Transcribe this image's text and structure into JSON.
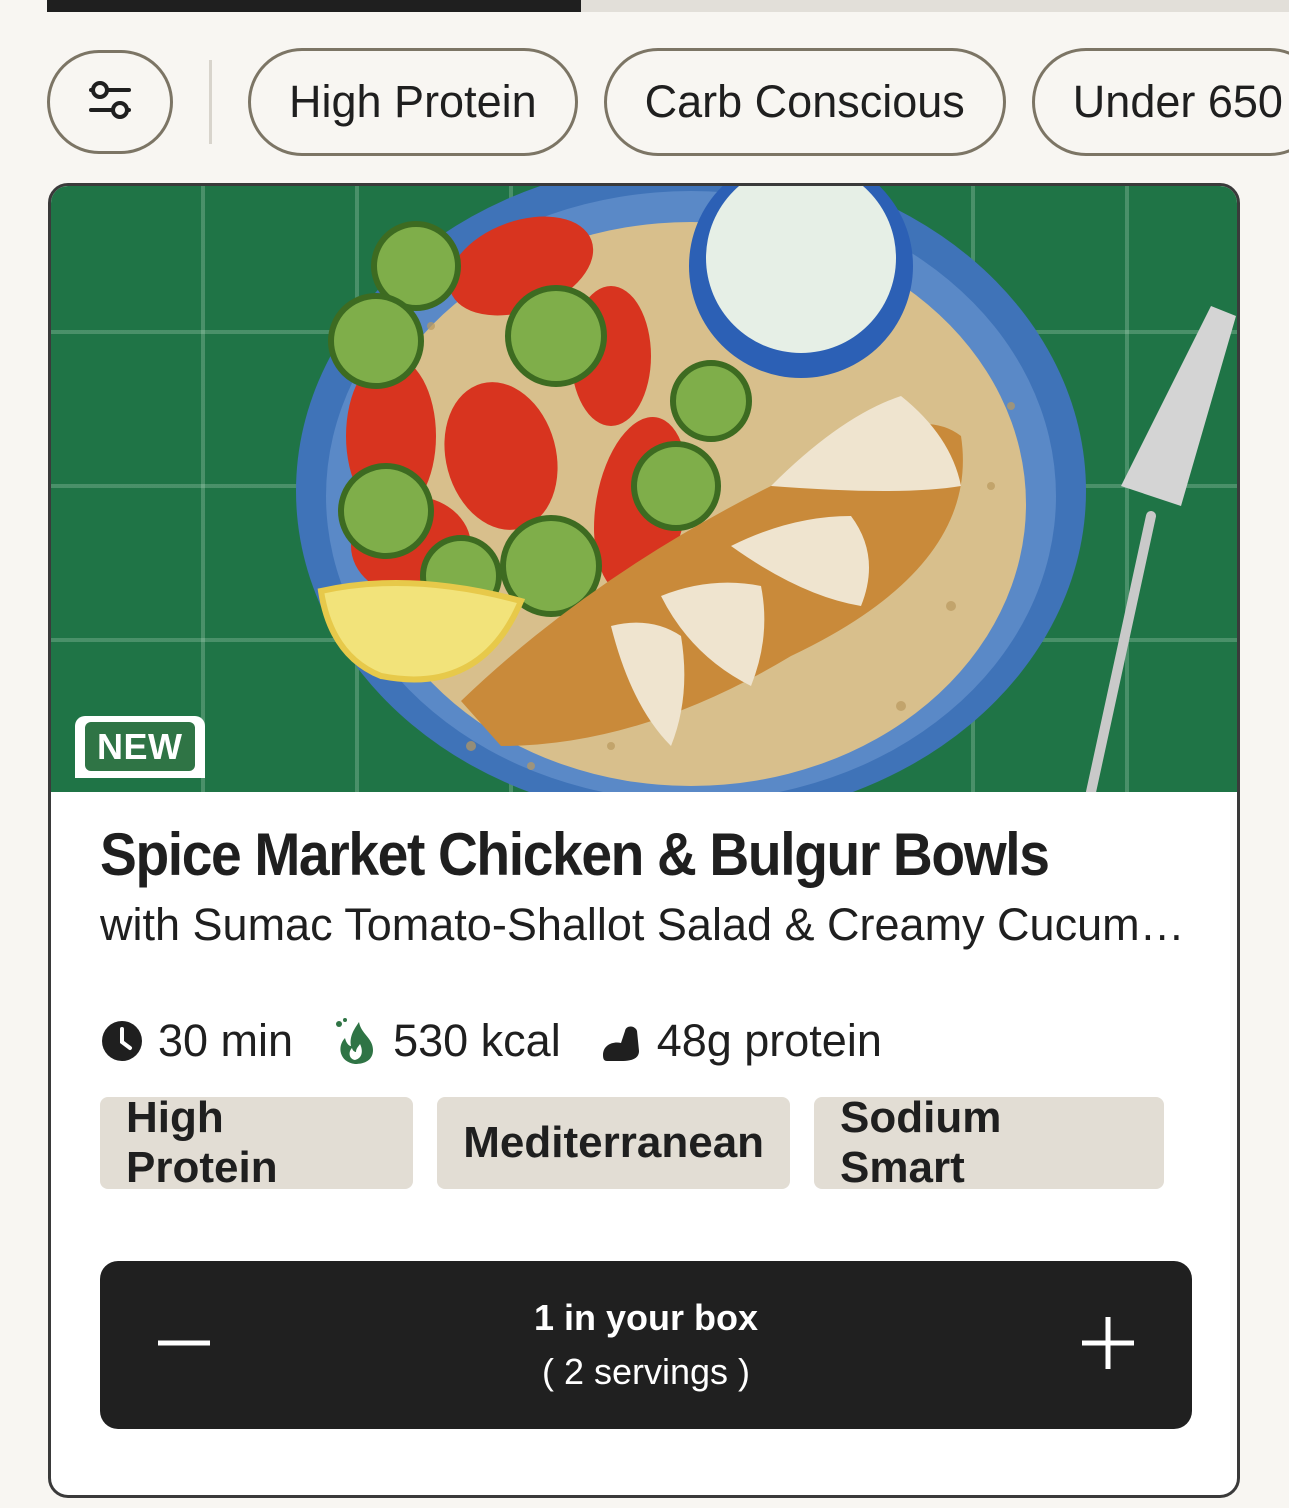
{
  "progress": {
    "fraction": 0.43
  },
  "filters": {
    "chips": [
      "High Protein",
      "Carb Conscious",
      "Under 650"
    ]
  },
  "recipe": {
    "badge": "NEW",
    "title": "Spice Market Chicken & Bulgur Bowls",
    "subtitle": "with Sumac Tomato-Shallot Salad & Creamy Cucumber",
    "stats": {
      "time": "30 min",
      "calories": "530 kcal",
      "protein": "48g protein"
    },
    "tags": [
      "High Protein",
      "Mediterranean",
      "Sodium Smart"
    ],
    "box": {
      "quantity_label": "1 in your box",
      "servings_label": "( 2 servings )"
    }
  },
  "colors": {
    "accent_green": "#2f7445",
    "button_dark": "#202020",
    "tag_bg": "#e2ddd4",
    "chip_border": "#7c7565"
  },
  "icons": [
    "sliders-icon",
    "clock-icon",
    "flame-icon",
    "flexed-arm-icon",
    "minus-icon",
    "plus-icon"
  ]
}
